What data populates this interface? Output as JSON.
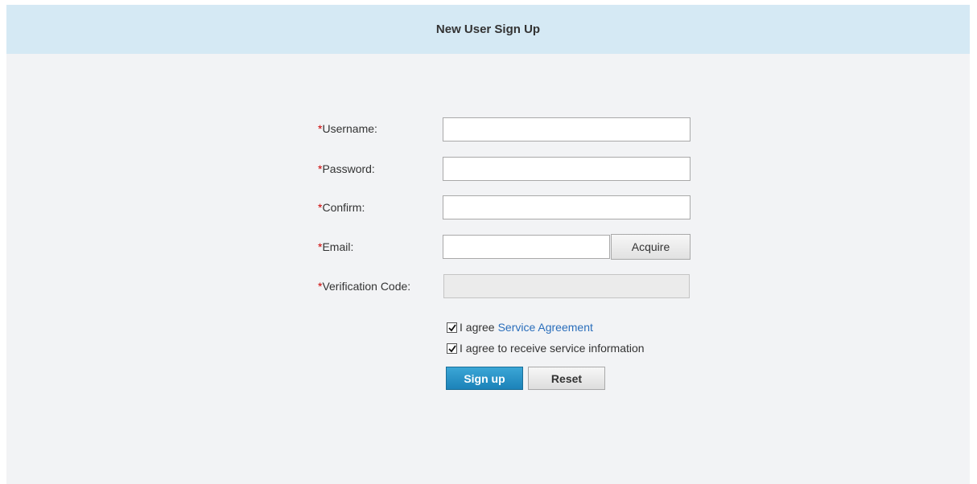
{
  "header": {
    "title": "New User Sign Up"
  },
  "form": {
    "required_marker": "*",
    "fields": [
      {
        "label": "Username:",
        "value": "",
        "placeholder": ""
      },
      {
        "label": "Password:",
        "value": "",
        "placeholder": ""
      },
      {
        "label": "Confirm:",
        "value": "",
        "placeholder": ""
      },
      {
        "label": "Email:",
        "value": "",
        "placeholder": ""
      },
      {
        "label": "Verification Code:",
        "value": "",
        "placeholder": ""
      }
    ],
    "acquire_label": "Acquire",
    "agree_service": {
      "checked": true,
      "prefix": "I agree",
      "link": "Service Agreement"
    },
    "agree_info": {
      "checked": true,
      "label": "I agree to receive service information"
    },
    "signup_label": "Sign up",
    "reset_label": "Reset"
  },
  "colors": {
    "header_bg": "#d5e9f4",
    "page_bg": "#f2f3f5",
    "required": "#cc0000",
    "link": "#2a6ebb",
    "primary_button": "#1c82b8"
  },
  "icons": {
    "checkbox": "check-icon"
  }
}
